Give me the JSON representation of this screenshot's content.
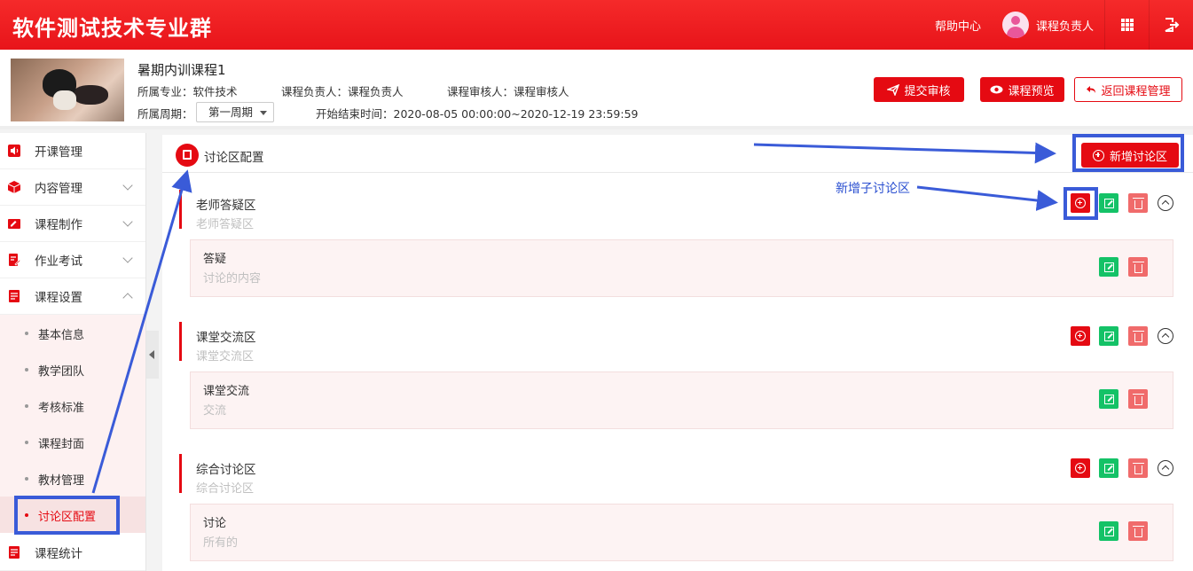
{
  "topbar": {
    "brand": "软件测试技术专业群",
    "help": "帮助中心",
    "user_name": "课程负责人"
  },
  "course": {
    "title": "暑期内训课程1",
    "major_label": "所属专业：软件技术",
    "leader_label": "课程负责人：课程负责人",
    "reviewer_label": "课程审核人：课程审核人",
    "period_label": "所属周期：",
    "period_value": "第一周期",
    "date_label": "开始结束时间：2020-08-05 00:00:00~2020-12-19 23:59:59",
    "buttons": {
      "submit": "提交审核",
      "preview": "课程预览",
      "back": "返回课程管理"
    }
  },
  "sidebar": {
    "items": [
      {
        "label": "开课管理"
      },
      {
        "label": "内容管理"
      },
      {
        "label": "课程制作"
      },
      {
        "label": "作业考试"
      },
      {
        "label": "课程设置"
      }
    ],
    "sub_items": [
      {
        "label": "基本信息"
      },
      {
        "label": "教学团队"
      },
      {
        "label": "考核标准"
      },
      {
        "label": "课程封面"
      },
      {
        "label": "教材管理"
      },
      {
        "label": "讨论区配置"
      }
    ],
    "bottom_item": {
      "label": "课程统计"
    }
  },
  "main": {
    "title": "讨论区配置",
    "add_button": "新增讨论区",
    "sections": [
      {
        "title": "老师答疑区",
        "subtitle": "老师答疑区",
        "child": {
          "title": "答疑",
          "subtitle": "讨论的内容"
        }
      },
      {
        "title": "课堂交流区",
        "subtitle": "课堂交流区",
        "child": {
          "title": "课堂交流",
          "subtitle": "交流"
        }
      },
      {
        "title": "综合讨论区",
        "subtitle": "综合讨论区",
        "child": {
          "title": "讨论",
          "subtitle": "所有的"
        }
      }
    ]
  },
  "annotation": {
    "label": "新增子讨论区",
    "color": "#3a5bd8"
  },
  "colors": {
    "brand_red": "#e50a12",
    "edit_green": "#14c267",
    "delete_pink": "#f06b6b"
  }
}
